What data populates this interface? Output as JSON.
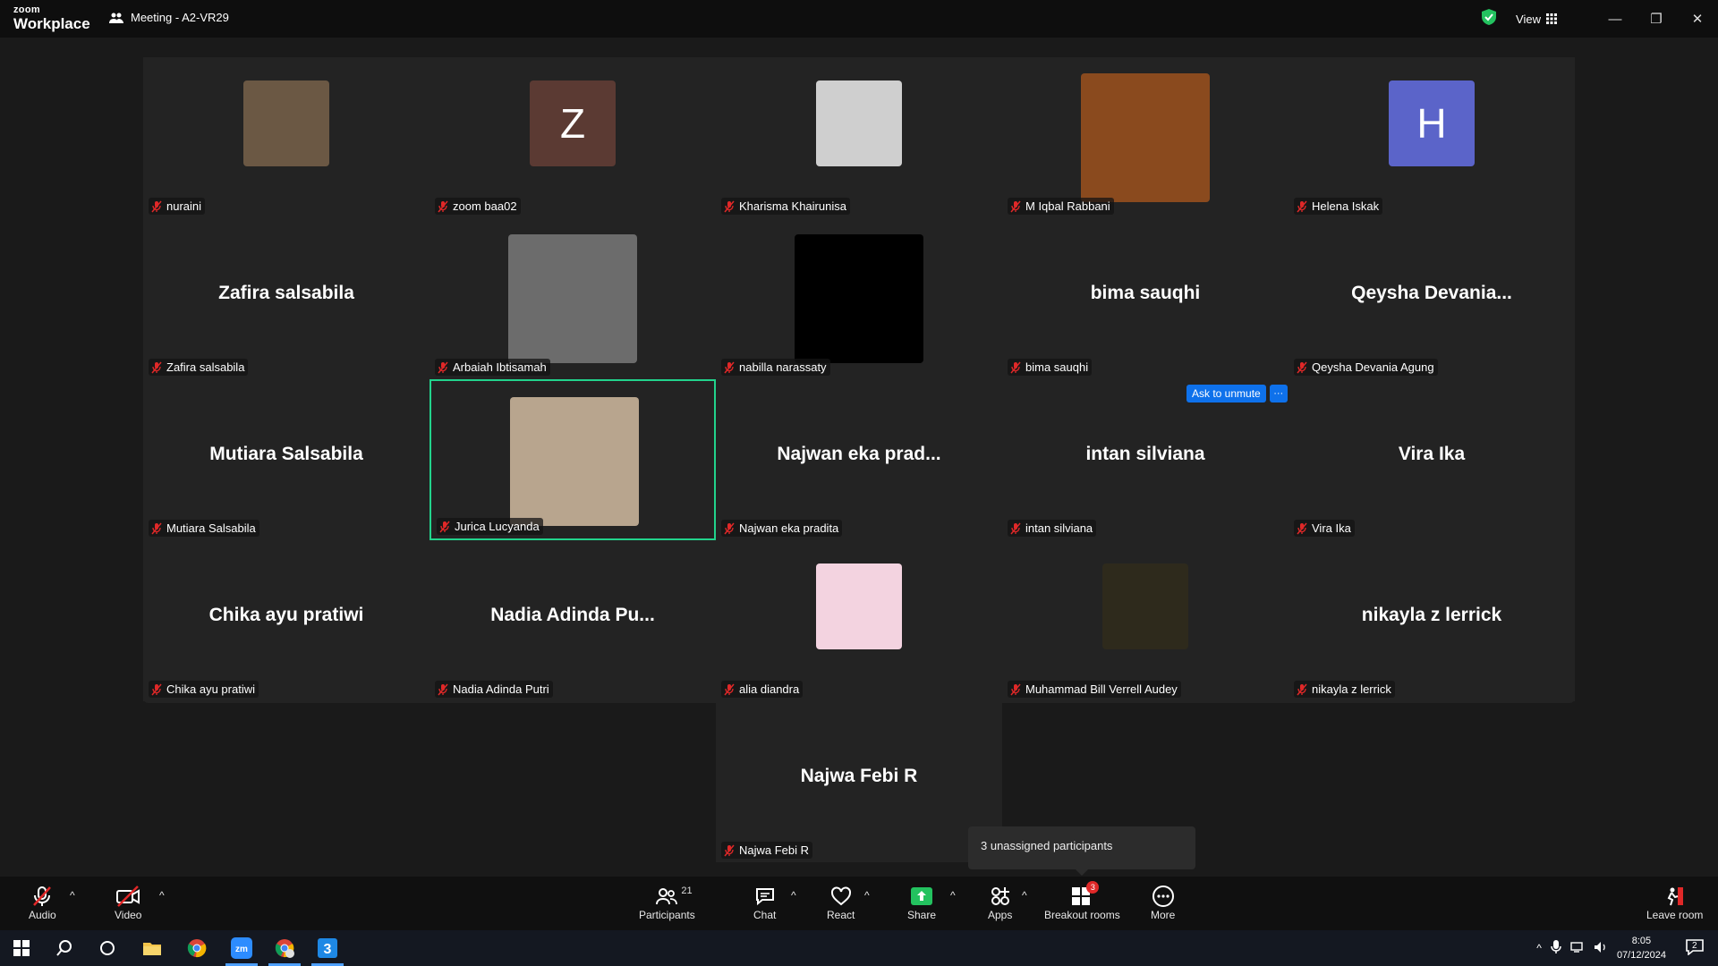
{
  "app": {
    "logo_small": "zoom",
    "logo_big": "Workplace",
    "meeting_title": "Meeting - A2-VR29",
    "view_label": "View"
  },
  "colors": {
    "active_speaker_border": "#22d38c",
    "accent_blue": "#0e71eb",
    "muted_red": "#e02828"
  },
  "tiles": [
    {
      "name": "nuraini",
      "type": "photo"
    },
    {
      "name": "zoom baa02",
      "type": "letter",
      "letter": "Z",
      "color": "#5b3a33"
    },
    {
      "name": "Kharisma Khairunisa",
      "type": "photo"
    },
    {
      "name": "M Iqbal Rabbani",
      "type": "photo"
    },
    {
      "name": "Helena Iskak",
      "type": "letter",
      "letter": "H",
      "color": "#5b64c9"
    },
    {
      "name": "Zafira salsabila",
      "type": "name",
      "display": "Zafira salsabila"
    },
    {
      "name": "Arbaiah Ibtisamah",
      "type": "photo"
    },
    {
      "name": "nabilla narassaty",
      "type": "photo"
    },
    {
      "name": "bima sauqhi",
      "type": "name",
      "display": "bima sauqhi"
    },
    {
      "name": "Qeysha Devania Agung",
      "type": "name",
      "display": "Qeysha Devania..."
    },
    {
      "name": "Mutiara Salsabila",
      "type": "name",
      "display": "Mutiara Salsabila"
    },
    {
      "name": "Jurica Lucyanda",
      "type": "photo",
      "active": true
    },
    {
      "name": "Najwan eka pradita",
      "type": "name",
      "display": "Najwan eka prad..."
    },
    {
      "name": "intan silviana",
      "type": "name",
      "display": "intan silviana"
    },
    {
      "name": "Vira Ika",
      "type": "name",
      "display": "Vira Ika"
    },
    {
      "name": "Chika ayu pratiwi",
      "type": "name",
      "display": "Chika ayu pratiwi"
    },
    {
      "name": "Nadia Adinda Putri",
      "type": "name",
      "display": "Nadia Adinda Pu..."
    },
    {
      "name": "alia diandra",
      "type": "photo"
    },
    {
      "name": "Muhammad Bill Verrell Audey",
      "type": "photo"
    },
    {
      "name": "nikayla z lerrick",
      "type": "name",
      "display": "nikayla z lerrick"
    },
    {
      "name": "Najwa Febi R",
      "type": "name",
      "display": "Najwa Febi R"
    }
  ],
  "ask_unmute": {
    "label": "Ask to unmute",
    "more": "···"
  },
  "unassigned_tooltip": "3 unassigned participants",
  "toolbar": {
    "audio": "Audio",
    "video": "Video",
    "participants": "Participants",
    "participants_count": "21",
    "chat": "Chat",
    "react": "React",
    "share": "Share",
    "apps": "Apps",
    "breakout": "Breakout rooms",
    "breakout_badge": "3",
    "more": "More",
    "leave": "Leave room"
  },
  "taskbar": {
    "time": "8:05",
    "date": "07/12/2024",
    "notifications": "2"
  }
}
